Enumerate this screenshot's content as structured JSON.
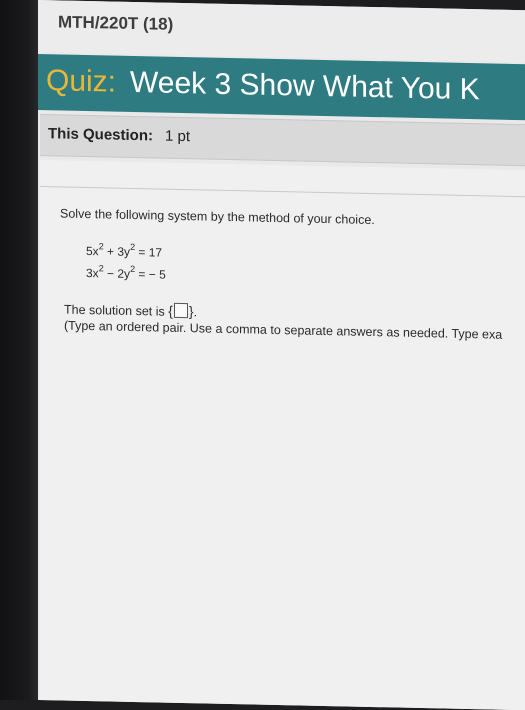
{
  "course": {
    "title": "MTH/220T (18)"
  },
  "quiz": {
    "prefix": "Quiz:",
    "name": "Week 3 Show What You K"
  },
  "question": {
    "label": "This Question:",
    "points": "1 pt"
  },
  "problem": {
    "instruction": "Solve the following system by the method of your choice.",
    "eq1": {
      "a": "5x",
      "b": " + 3y",
      "c": " = 17"
    },
    "eq2": {
      "a": "3x",
      "b": " − 2y",
      "c": " = − 5"
    },
    "exponent": "2",
    "answer_prefix": "The solution set is ",
    "open_brace": "{",
    "close_brace": "}",
    "period": ".",
    "hint": "(Type an ordered pair. Use a comma to separate answers as needed. Type exa"
  }
}
